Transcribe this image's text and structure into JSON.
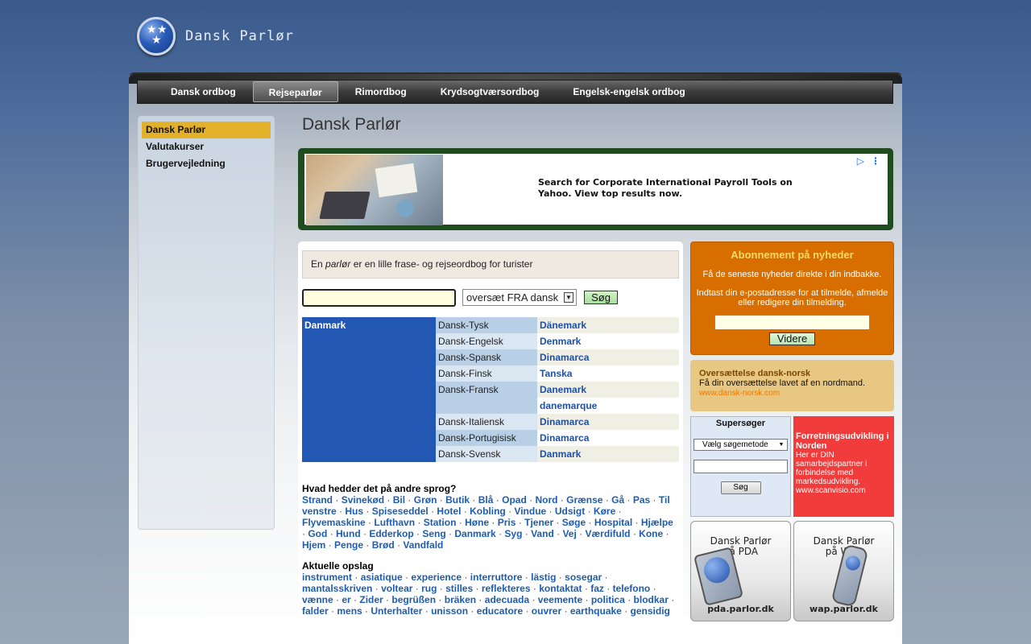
{
  "site": {
    "logo_title": "Dansk Parlør"
  },
  "nav": {
    "tabs": [
      {
        "label": "Dansk ordbog"
      },
      {
        "label": "Rejseparlør"
      },
      {
        "label": "Rimordbog"
      },
      {
        "label": "Krydsogtværsordbog"
      },
      {
        "label": "Engelsk-engelsk ordbog"
      }
    ],
    "active_index": 1
  },
  "sidebar": {
    "items": [
      {
        "label": "Dansk Parlør"
      },
      {
        "label": "Valutakurser"
      },
      {
        "label": "Brugervejledning"
      }
    ]
  },
  "page": {
    "title": "Dansk Parlør"
  },
  "ad": {
    "text": "Search for Corporate International Payroll Tools on Yahoo. View top results now."
  },
  "parlor": {
    "intro_prefix": "En ",
    "intro_em": "parlør",
    "intro_suffix": " er en lille frase- og rejseordbog for turister",
    "search_placeholder": "",
    "direction_select": "oversæt FRA dansk",
    "search_button": "Søg"
  },
  "dictionary": {
    "country": "Danmark",
    "rows": [
      {
        "lang": "Dansk-Tysk",
        "word": "Dänemark"
      },
      {
        "lang": "Dansk-Engelsk",
        "word": "Denmark"
      },
      {
        "lang": "Dansk-Spansk",
        "word": "Dinamarca"
      },
      {
        "lang": "Dansk-Finsk",
        "word": "Tanska"
      },
      {
        "lang": "Dansk-Fransk",
        "word": "Danemark"
      },
      {
        "lang": "",
        "word": "danemarque"
      },
      {
        "lang": "Dansk-Italiensk",
        "word": "Dinamarca"
      },
      {
        "lang": "Dansk-Portugisisk",
        "word": "Dinamarca"
      },
      {
        "lang": "Dansk-Svensk",
        "word": "Danmark"
      }
    ],
    "colors": {
      "country_bg": "#2258b4",
      "lang_a": "#b8cfe6",
      "lang_b": "#dbe6f3",
      "word_a": "#f0efe4",
      "word_b": "#ffffff"
    }
  },
  "other_languages": {
    "heading": "Hvad hedder det på andre sprog?",
    "words": [
      "Strand",
      "Svinekød",
      "Bil",
      "Grøn",
      "Butik",
      "Blå",
      "Opad",
      "Nord",
      "Grænse",
      "Gå",
      "Pas",
      "Til venstre",
      "Hus",
      "Spiseseddel",
      "Hotel",
      "Kobling",
      "Vindue",
      "Udsigt",
      "Køre",
      "Flyvemaskine",
      "Lufthavn",
      "Station",
      "Høne",
      "Pris",
      "Tjener",
      "Søge",
      "Hospital",
      "Hjælpe",
      "God",
      "Hund",
      "Edderkop",
      "Seng",
      "Danmark",
      "Syg",
      "Vand",
      "Vej",
      "Værdifuld",
      "Kone",
      "Hjem",
      "Penge",
      "Brød",
      "Vandfald"
    ]
  },
  "recent": {
    "heading": "Aktuelle opslag",
    "words": [
      "instrument",
      "asiatique",
      "experience",
      "interruttore",
      "lästig",
      "sosegar",
      "mantalsskriven",
      "voltear",
      "rug",
      "stilles",
      "reflekteres",
      "kontaktat",
      "faz",
      "telefono",
      "vænne",
      "er",
      "Zider",
      "begrüßen",
      "bräken",
      "adecuada",
      "veemente",
      "politica",
      "blodkar",
      "falder",
      "mens",
      "Unterhalter",
      "unisson",
      "educatore",
      "ouvrer",
      "earthquake",
      "gensidig"
    ]
  },
  "newsletter": {
    "heading": "Abonnement på nyheder",
    "line1": "Få de seneste nyheder direkte i din indbakke.",
    "line2": "Indtast din e-postadresse for at tilmelde, afmelde eller redigere din tilmelding.",
    "button": "Videre"
  },
  "danish_norsk": {
    "heading": "Oversættelse dansk-norsk",
    "text": "Få din oversættelse lavet af en nordmand.",
    "url": "www.dansk-norsk.com"
  },
  "supersoger": {
    "heading": "Supersøger",
    "select": "Vælg søgemetode",
    "button": "Søg"
  },
  "scanvisio": {
    "heading": "Forretningsudvikling i Norden",
    "text": "Her er DIN samarbejdspartner i forbindelse med markedsudvikling.",
    "url": "www.scanvisio.com"
  },
  "promos": {
    "pda": {
      "line1": "Dansk Parlør",
      "line2": "på PDA",
      "url": "pda.parlor.dk"
    },
    "wap": {
      "line1": "Dansk Parlør",
      "line2": "på WAP",
      "url": "wap.parlor.dk"
    }
  }
}
